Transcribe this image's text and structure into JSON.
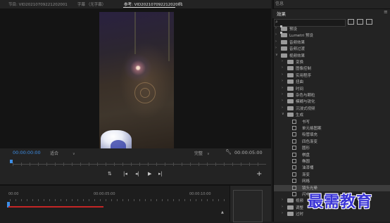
{
  "monitor": {
    "tabs": [
      {
        "label": "节目: VID20210709221202001",
        "active": false
      },
      {
        "label": "字幕 （无字幕）",
        "active": false
      },
      {
        "label": "参考: VID20210709221202001",
        "active": true
      }
    ],
    "tab_menu_icon": "hamburger-icon",
    "timecode": "00:00:00:00",
    "fit_label": "适合",
    "quality_label": "完整",
    "duration": "00:00:05:00",
    "transport_icons": [
      "marker-icon",
      "step-back-icon",
      "play-icon",
      "step-forward-icon",
      "go-to-end-icon"
    ],
    "add_icon": "plus-icon"
  },
  "timeline": {
    "ruler_labels": [
      "00:00",
      "00:00:05:00",
      "00:00:10:00"
    ],
    "playhead_color": "#3d8ee6",
    "work_area_color": "#c42626"
  },
  "panel": {
    "info_tab": "信息",
    "effects_title": "效果",
    "menu_icon": "menu-icon",
    "search_icon": "search-icon",
    "bin_icons": [
      "accelerated-effects-icon",
      "32bit-effects-icon",
      "yuv-effects-icon"
    ],
    "tree": [
      {
        "label": "预设",
        "level": 0,
        "type": "folder-star",
        "expanded": false
      },
      {
        "label": "Lumetri 预设",
        "level": 0,
        "type": "folder-star",
        "expanded": false
      },
      {
        "label": "音频效果",
        "level": 0,
        "type": "folder",
        "expanded": false
      },
      {
        "label": "音频过渡",
        "level": 0,
        "type": "folder",
        "expanded": false
      },
      {
        "label": "视频效果",
        "level": 0,
        "type": "folder",
        "expanded": true
      },
      {
        "label": "变换",
        "level": 1,
        "type": "folder",
        "expanded": false
      },
      {
        "label": "图像控制",
        "level": 1,
        "type": "folder",
        "expanded": false
      },
      {
        "label": "实用程序",
        "level": 1,
        "type": "folder",
        "expanded": false
      },
      {
        "label": "扭曲",
        "level": 1,
        "type": "folder",
        "expanded": false
      },
      {
        "label": "时间",
        "level": 1,
        "type": "folder",
        "expanded": false
      },
      {
        "label": "杂色与颗粒",
        "level": 1,
        "type": "folder",
        "expanded": false
      },
      {
        "label": "模糊与锐化",
        "level": 1,
        "type": "folder",
        "expanded": false
      },
      {
        "label": "沉浸式视频",
        "level": 1,
        "type": "folder",
        "expanded": false
      },
      {
        "label": "生成",
        "level": 1,
        "type": "folder",
        "expanded": true
      },
      {
        "label": "书写",
        "level": 2,
        "type": "effect"
      },
      {
        "label": "单元格图案",
        "level": 2,
        "type": "effect"
      },
      {
        "label": "吸管填充",
        "level": 2,
        "type": "effect"
      },
      {
        "label": "四色渐变",
        "level": 2,
        "type": "effect"
      },
      {
        "label": "圆形",
        "level": 2,
        "type": "effect"
      },
      {
        "label": "棋盘",
        "level": 2,
        "type": "effect"
      },
      {
        "label": "椭圆",
        "level": 2,
        "type": "effect"
      },
      {
        "label": "油漆桶",
        "level": 2,
        "type": "effect"
      },
      {
        "label": "渐变",
        "level": 2,
        "type": "effect"
      },
      {
        "label": "网格",
        "level": 2,
        "type": "effect"
      },
      {
        "label": "镜头光晕",
        "level": 2,
        "type": "effect",
        "selected": true
      },
      {
        "label": "闪电",
        "level": 2,
        "type": "effect"
      },
      {
        "label": "视频",
        "level": 1,
        "type": "folder",
        "expanded": false
      },
      {
        "label": "调整",
        "level": 1,
        "type": "folder",
        "expanded": false
      },
      {
        "label": "过时",
        "level": 1,
        "type": "folder",
        "expanded": false
      }
    ]
  },
  "watermark": "最需教育"
}
